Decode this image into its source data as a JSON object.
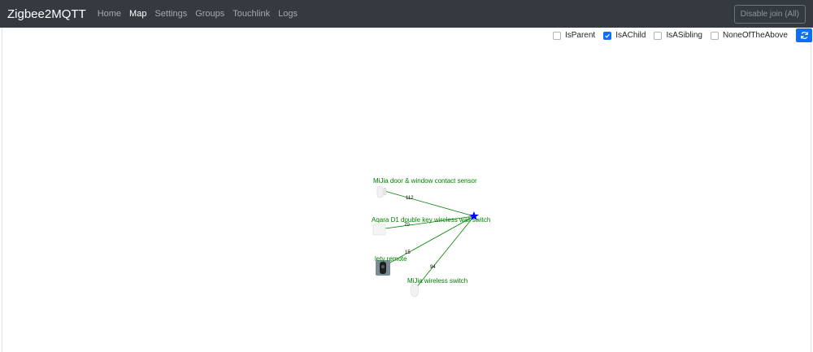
{
  "navbar": {
    "brand": "Zigbee2MQTT",
    "links": [
      {
        "label": "Home",
        "active": false
      },
      {
        "label": "Map",
        "active": true
      },
      {
        "label": "Settings",
        "active": false
      },
      {
        "label": "Groups",
        "active": false
      },
      {
        "label": "Touchlink",
        "active": false
      },
      {
        "label": "Logs",
        "active": false
      }
    ],
    "join_button": "Disable join (All)"
  },
  "filters": [
    {
      "label": "IsParent",
      "checked": false
    },
    {
      "label": "IsAChild",
      "checked": true
    },
    {
      "label": "IsASibling",
      "checked": false
    },
    {
      "label": "NoneOfTheAbove",
      "checked": false
    }
  ],
  "refresh_icon": "refresh-icon",
  "map": {
    "coordinator_icon": "star-icon",
    "nodes": [
      {
        "label": "MiJia door & window contact sensor",
        "icon": "door-sensor-icon",
        "lqi": "112"
      },
      {
        "label": "Aqara D1 double key wireless wall switch",
        "icon": "wall-switch-icon",
        "lqi": "70"
      },
      {
        "label": "lety remote",
        "icon": "remote-icon",
        "lqi": "15"
      },
      {
        "label": "MiJia wireless switch",
        "icon": "wireless-switch-icon",
        "lqi": "94"
      }
    ]
  },
  "colors": {
    "navbar_bg": "#343a40",
    "accent": "#0d6efd",
    "node_label": "#008000",
    "link_line": "#008000",
    "coordinator": "#0000ff"
  }
}
